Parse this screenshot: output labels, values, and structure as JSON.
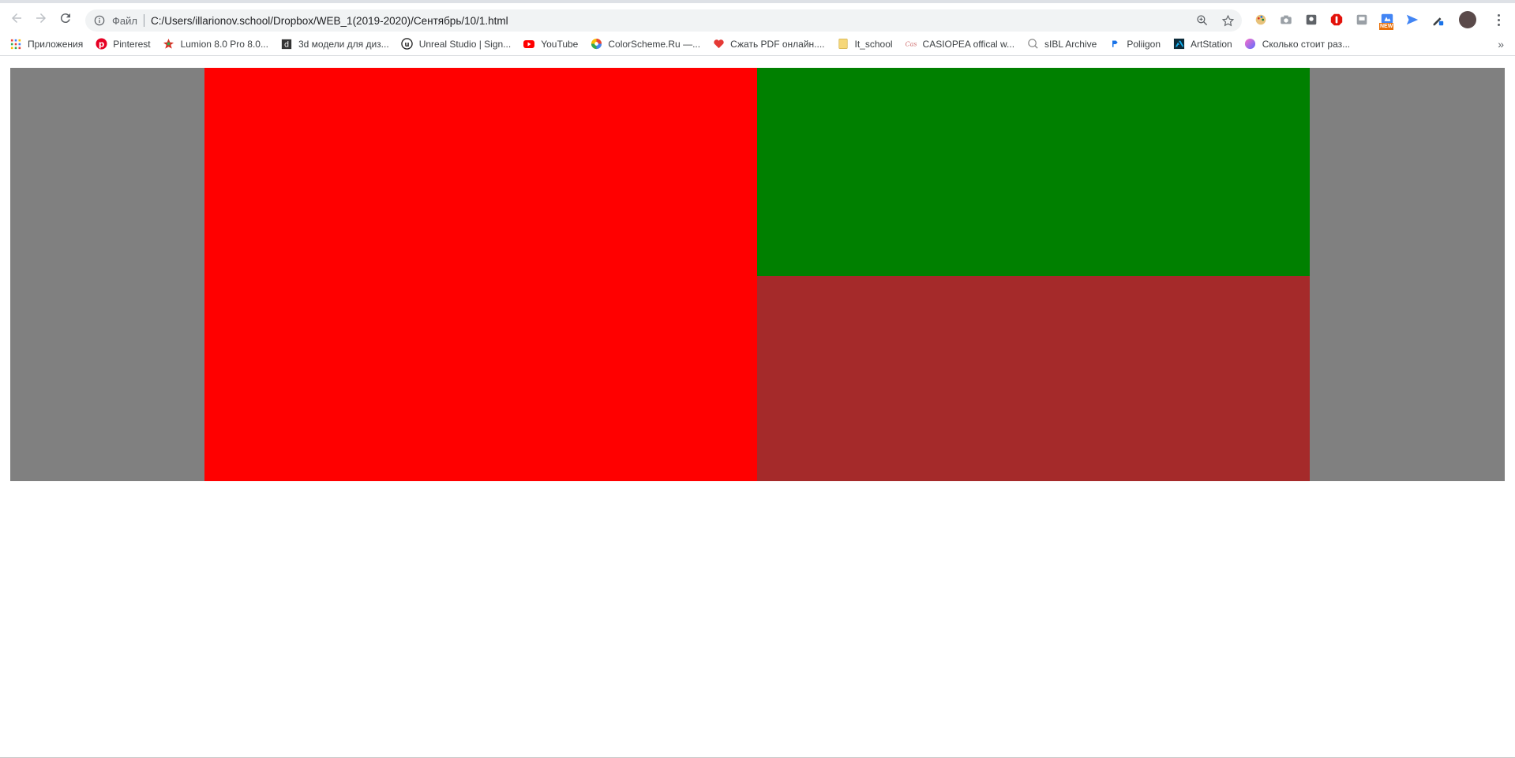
{
  "browser": {
    "address_scheme": "Файл",
    "address_url": "C:/Users/illarionov.school/Dropbox/WEB_1(2019-2020)/Сентябрь/10/1.html",
    "extensions": [
      "color-picker-icon",
      "camera-icon",
      "shield-extension-icon",
      "adblock-icon",
      "tray-icon",
      "new-badge-icon",
      "send-icon",
      "pen-tool-icon"
    ],
    "new_badge": "NEW"
  },
  "bookmarks": [
    {
      "label": "Приложения",
      "icon": "apps-grid-icon",
      "color": "#ea4335"
    },
    {
      "label": "Pinterest",
      "icon": "pinterest-icon",
      "color": "#e60023"
    },
    {
      "label": "Lumion 8.0 Pro 8.0...",
      "icon": "lumion-icon",
      "color": "#d93025"
    },
    {
      "label": "3d модели для диз...",
      "icon": "3d-models-icon",
      "color": "#333333"
    },
    {
      "label": "Unreal Studio | Sign...",
      "icon": "unreal-icon",
      "color": "#222222"
    },
    {
      "label": "YouTube",
      "icon": "youtube-icon",
      "color": "#ff0000"
    },
    {
      "label": "ColorScheme.Ru —...",
      "icon": "colorscheme-icon",
      "color": "#fbbc05"
    },
    {
      "label": "Сжать PDF онлайн....",
      "icon": "heart-pdf-icon",
      "color": "#e53935"
    },
    {
      "label": "It_school",
      "icon": "folder-icon",
      "color": "#f6d77a"
    },
    {
      "label": "CASIOPEA offical w...",
      "icon": "casiopea-icon",
      "color": "#d07070"
    },
    {
      "label": "sIBL Archive",
      "icon": "sibl-icon",
      "color": "#888888"
    },
    {
      "label": "Poliigon",
      "icon": "poliigon-icon",
      "color": "#1a73e8"
    },
    {
      "label": "ArtStation",
      "icon": "artstation-icon",
      "color": "#13aff0"
    },
    {
      "label": "Сколько стоит раз...",
      "icon": "circle-gradient-icon",
      "color": "#7b61ff"
    }
  ],
  "colors": {
    "gray": "#808080",
    "red": "#ff0000",
    "green": "#008000",
    "brown": "#a52a2a"
  }
}
